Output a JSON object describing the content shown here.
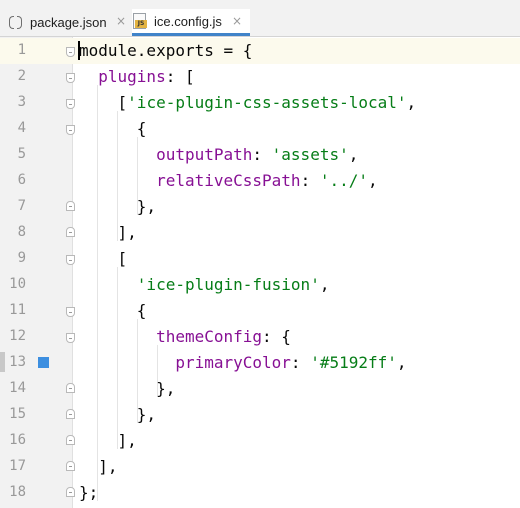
{
  "tabs": [
    {
      "label": "package.json",
      "icon": "json-file-icon",
      "active": false,
      "close": "×"
    },
    {
      "label": "ice.config.js",
      "icon": "js-file-icon",
      "active": true,
      "close": "×",
      "badge": "JS"
    }
  ],
  "editor": {
    "language": "javascript",
    "current_line": 1,
    "bookmarked_line": 13,
    "colors": {
      "background": "#ffffff",
      "gutter": "#f2f2f2",
      "property": "#871094",
      "string": "#067d17",
      "bookmark": "#3d8fe0",
      "active_tab_underline": "#4083c9"
    },
    "lines": [
      {
        "n": "1",
        "tokens": [
          {
            "t": "module",
            "c": "kw"
          },
          {
            "t": ".exports = {",
            "c": "kw"
          }
        ]
      },
      {
        "n": "2",
        "tokens": [
          {
            "t": "  ",
            "c": "kw"
          },
          {
            "t": "plugins",
            "c": "prop"
          },
          {
            "t": ": [",
            "c": "kw"
          }
        ]
      },
      {
        "n": "3",
        "tokens": [
          {
            "t": "    [",
            "c": "kw"
          },
          {
            "t": "'ice-plugin-css-assets-local'",
            "c": "str"
          },
          {
            "t": ",",
            "c": "kw"
          }
        ]
      },
      {
        "n": "4",
        "tokens": [
          {
            "t": "      {",
            "c": "kw"
          }
        ]
      },
      {
        "n": "5",
        "tokens": [
          {
            "t": "        ",
            "c": "kw"
          },
          {
            "t": "outputPath",
            "c": "prop"
          },
          {
            "t": ": ",
            "c": "kw"
          },
          {
            "t": "'assets'",
            "c": "str"
          },
          {
            "t": ",",
            "c": "kw"
          }
        ]
      },
      {
        "n": "6",
        "tokens": [
          {
            "t": "        ",
            "c": "kw"
          },
          {
            "t": "relativeCssPath",
            "c": "prop"
          },
          {
            "t": ": ",
            "c": "kw"
          },
          {
            "t": "'../'",
            "c": "str"
          },
          {
            "t": ",",
            "c": "kw"
          }
        ]
      },
      {
        "n": "7",
        "tokens": [
          {
            "t": "      },",
            "c": "kw"
          }
        ]
      },
      {
        "n": "8",
        "tokens": [
          {
            "t": "    ],",
            "c": "kw"
          }
        ]
      },
      {
        "n": "9",
        "tokens": [
          {
            "t": "    [",
            "c": "kw"
          }
        ]
      },
      {
        "n": "10",
        "tokens": [
          {
            "t": "      ",
            "c": "kw"
          },
          {
            "t": "'ice-plugin-fusion'",
            "c": "str"
          },
          {
            "t": ",",
            "c": "kw"
          }
        ]
      },
      {
        "n": "11",
        "tokens": [
          {
            "t": "      {",
            "c": "kw"
          }
        ]
      },
      {
        "n": "12",
        "tokens": [
          {
            "t": "        ",
            "c": "kw"
          },
          {
            "t": "themeConfig",
            "c": "prop"
          },
          {
            "t": ": {",
            "c": "kw"
          }
        ]
      },
      {
        "n": "13",
        "tokens": [
          {
            "t": "          ",
            "c": "kw"
          },
          {
            "t": "primaryColor",
            "c": "prop"
          },
          {
            "t": ": ",
            "c": "kw"
          },
          {
            "t": "'#5192ff'",
            "c": "str"
          },
          {
            "t": ",",
            "c": "kw"
          }
        ]
      },
      {
        "n": "14",
        "tokens": [
          {
            "t": "        },",
            "c": "kw"
          }
        ]
      },
      {
        "n": "15",
        "tokens": [
          {
            "t": "      },",
            "c": "kw"
          }
        ]
      },
      {
        "n": "16",
        "tokens": [
          {
            "t": "    ],",
            "c": "kw"
          }
        ]
      },
      {
        "n": "17",
        "tokens": [
          {
            "t": "  ],",
            "c": "kw"
          }
        ]
      },
      {
        "n": "18",
        "tokens": [
          {
            "t": "};",
            "c": "kw"
          }
        ]
      }
    ],
    "folds": [
      {
        "line": 1,
        "kind": "open"
      },
      {
        "line": 2,
        "kind": "open"
      },
      {
        "line": 3,
        "kind": "open"
      },
      {
        "line": 4,
        "kind": "open"
      },
      {
        "line": 7,
        "kind": "close"
      },
      {
        "line": 8,
        "kind": "close"
      },
      {
        "line": 9,
        "kind": "open"
      },
      {
        "line": 11,
        "kind": "open"
      },
      {
        "line": 12,
        "kind": "open"
      },
      {
        "line": 14,
        "kind": "close"
      },
      {
        "line": 15,
        "kind": "close"
      },
      {
        "line": 16,
        "kind": "close"
      },
      {
        "line": 17,
        "kind": "close"
      },
      {
        "line": 18,
        "kind": "close"
      }
    ]
  }
}
